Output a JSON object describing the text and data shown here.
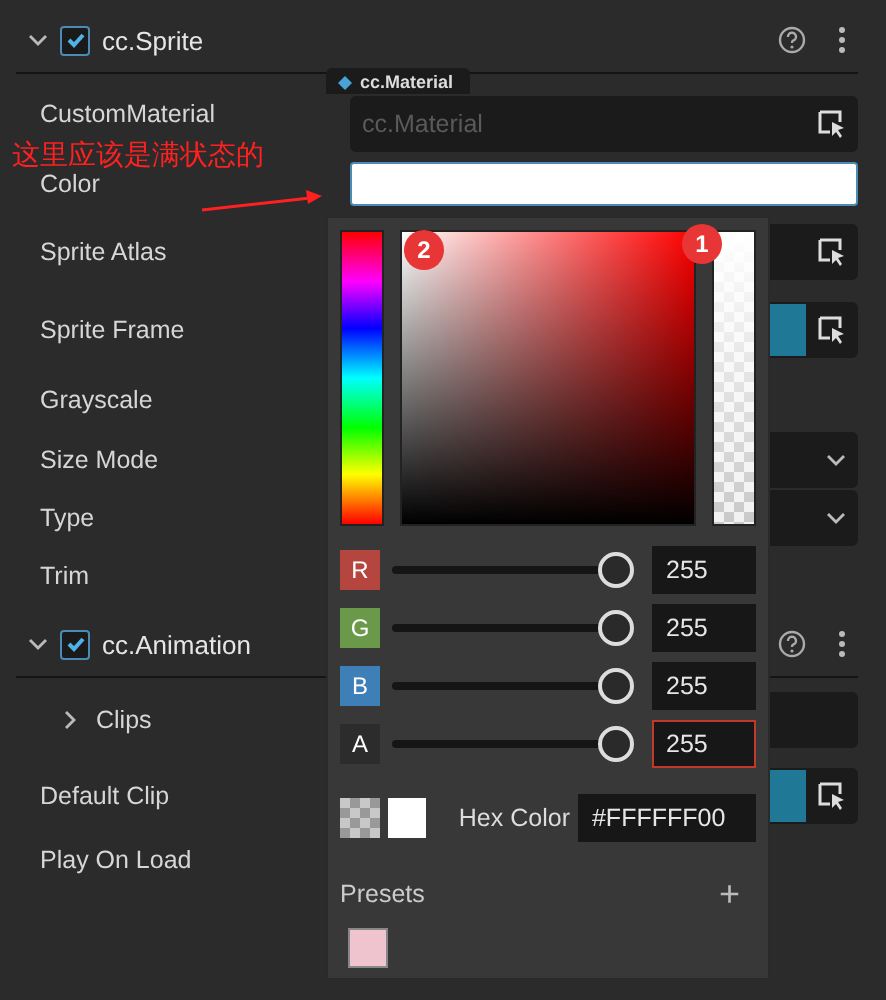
{
  "components": [
    {
      "title": "cc.Sprite",
      "enabled": true,
      "expanded": true,
      "properties": [
        {
          "label": "CustomMaterial",
          "kind": "asset",
          "tag": "cc.Material",
          "placeholder": "cc.Material"
        },
        {
          "label": "Color",
          "kind": "color"
        },
        {
          "label": "Sprite Atlas",
          "kind": "asset"
        },
        {
          "label": "Sprite Frame",
          "kind": "swatch-asset"
        },
        {
          "label": "Grayscale",
          "kind": "plain"
        },
        {
          "label": "Size Mode",
          "kind": "select"
        },
        {
          "label": "Type",
          "kind": "select"
        },
        {
          "label": "Trim",
          "kind": "plain"
        }
      ]
    },
    {
      "title": "cc.Animation",
      "enabled": true,
      "expanded": true,
      "properties": [
        {
          "label": "Clips",
          "kind": "array",
          "expanded": false
        },
        {
          "label": "Default Clip",
          "kind": "swatch-asset"
        },
        {
          "label": "Play On Load",
          "kind": "plain"
        }
      ]
    }
  ],
  "color_picker": {
    "channels": [
      {
        "label": "R",
        "value": "255",
        "level": 1,
        "color": "#b5463f",
        "highlighted": false
      },
      {
        "label": "G",
        "value": "255",
        "level": 1,
        "color": "#6a9a49",
        "highlighted": false
      },
      {
        "label": "B",
        "value": "255",
        "level": 1,
        "color": "#3f7fb8",
        "highlighted": false
      },
      {
        "label": "A",
        "value": "255",
        "level": 1,
        "color": "#2c2c2c",
        "highlighted": true
      }
    ],
    "hex_label": "Hex Color",
    "hex_value": "#FFFFFF00",
    "presets_title": "Presets",
    "add_label": "+",
    "presets": [
      {
        "color": "#f0c4cf"
      }
    ]
  },
  "annotation": {
    "text": "这里应该是满状态的",
    "badges": [
      "2",
      "1"
    ]
  }
}
